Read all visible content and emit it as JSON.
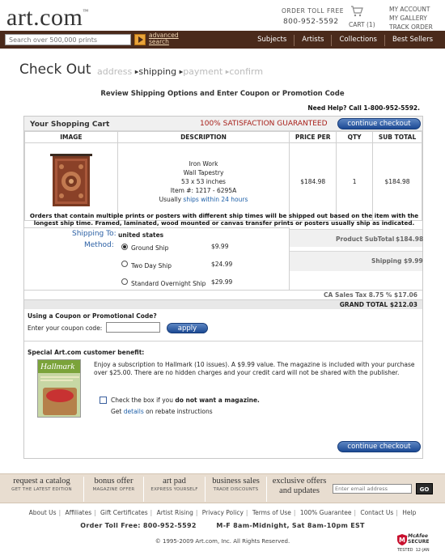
{
  "header": {
    "logo": "art.com",
    "logo_tm": "™",
    "order_label": "ORDER TOLL FREE",
    "order_phone": "800-952-5592",
    "cart_label": "CART (1)",
    "account_links": [
      "MY ACCOUNT",
      "MY GALLERY",
      "TRACK ORDER"
    ]
  },
  "nav": {
    "search_placeholder": "Search over 500,000 prints",
    "advanced_search_1": "advanced",
    "advanced_search_2": "search",
    "links": [
      "Subjects",
      "Artists",
      "Collections",
      "Best Sellers"
    ]
  },
  "checkout": {
    "title": "Check Out",
    "steps": [
      "address",
      "shipping",
      "payment",
      "confirm"
    ],
    "current_step": "shipping",
    "review_heading": "Review Shipping Options and Enter Coupon or Promotion Code",
    "help": "Need Help? Call 1-800-952-5592."
  },
  "cart": {
    "title": "Your Shopping Cart",
    "guarantee": "100% SATISFACTION GUARANTEED",
    "continue_label": "continue checkout",
    "columns": [
      "IMAGE",
      "DESCRIPTION",
      "PRICE PER",
      "QTY",
      "SUB TOTAL"
    ],
    "item": {
      "line1": "Iron Work",
      "line2": "Wall Tapestry",
      "line3": "53 x 53 inches",
      "line4": "Item #: 1217 - 6295A",
      "usually": "Usually",
      "ships": "ships within 24 hours",
      "price": "$184.98",
      "qty": "1",
      "subtotal": "$184.98"
    },
    "ship_note": "Orders that contain multiple prints or posters with different ship times will be shipped out based on the item with the longest ship time. Framed, laminated, wood mounted or canvas transfer prints or posters usually ship as indicated."
  },
  "shipping": {
    "ship_to_label": "Shipping To:",
    "ship_to_value": "united states",
    "method_label": "Method:",
    "options": [
      {
        "label": "Ground Ship",
        "price": "$9.99",
        "selected": true
      },
      {
        "label": "Two Day Ship",
        "price": "$24.99",
        "selected": false
      },
      {
        "label": "Standard Overnight Ship",
        "price": "$29.99",
        "selected": false
      }
    ]
  },
  "summary": {
    "product_subtotal_label": "Product SubTotal",
    "product_subtotal": "$184.98",
    "shipping_label": "Shipping",
    "shipping": "$9.99",
    "tax": "CA Sales Tax 8.75 % $17.06",
    "grand_total": "GRAND TOTAL $212.03"
  },
  "coupon": {
    "question": "Using a Coupon or Promotional Code?",
    "label": "Enter your coupon code:",
    "value": "",
    "apply_label": "apply"
  },
  "benefit": {
    "heading": "Special Art.com customer benefit:",
    "magazine_name": "Hallmark",
    "text": "Enjoy a subscription to Hallmark (10 issues). A $9.99 value. The magazine is included with your purchase over $25.00. There are no hidden charges and your credit card will not be shared with the publisher.",
    "check_pre": "Check the box if you ",
    "check_bold": "do not want a magazine.",
    "get": "Get ",
    "details": "details",
    "rebate": " on rebate instructions"
  },
  "promos": [
    {
      "title": "request a catalog",
      "sub": "GET THE LATEST EDITION"
    },
    {
      "title": "bonus offer",
      "sub": "MAGAZINE OFFER"
    },
    {
      "title": "art pad",
      "sub": "EXPRESS YOURSELF"
    },
    {
      "title": "business sales",
      "sub": "TRADE DISCOUNTS"
    },
    {
      "title": "exclusive offers",
      "title2": "and updates"
    }
  ],
  "email": {
    "placeholder": "Enter email address",
    "go": "GO"
  },
  "footer": {
    "links": [
      "About Us",
      "Affiliates",
      "Gift Certificates",
      "Artist Rising",
      "Privacy Policy",
      "Terms of Use",
      "100% Guarantee",
      "Contact Us",
      "Help"
    ],
    "phone": "Order Toll Free: 800-952-5592        M-F 8am-Midnight, Sat 8am-10pm EST",
    "copyright": "© 1995-2009 Art.com, Inc. All Rights Reserved.",
    "mcafee_1": "McAfee",
    "mcafee_2": "SECURE",
    "mcafee_3": "TESTED  12-JAN"
  },
  "colors": {
    "nav_bg": "#4a2a1b",
    "accent_blue": "#1c4a94",
    "guarantee_red": "#a8201a",
    "promo_bg": "#e8ddd0"
  }
}
